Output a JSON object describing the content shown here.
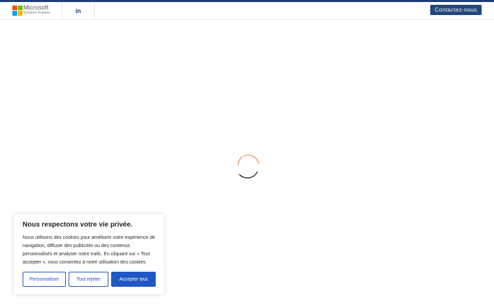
{
  "header": {
    "logo": {
      "title": "Microsoft",
      "subtitle": "Solution Partner",
      "colors": [
        "#f25022",
        "#7fba00",
        "#00a4ef",
        "#ffb900"
      ]
    },
    "linkedin": {
      "icon": "linkedin-icon",
      "glyph": "in"
    },
    "contact_label": "Contactez-nous",
    "colors": {
      "top_strip": "#1f3f73",
      "contact_button": "#22477a"
    }
  },
  "main": {
    "loading_icon": "spinner-icon",
    "spinner_colors": [
      "#e58a4e",
      "#1b1b1b"
    ]
  },
  "cookie_banner": {
    "title": "Nous respectons votre vie privée.",
    "body_lines": [
      "Nous utilisons des cookies pour améliorer votre expérience de",
      "navigation, diffuser des publicités ou des contenus",
      "personnalisés et analyser notre trafic. En cliquant sur « Tout",
      "accepter », vous consentez à notre utilisation des cookies."
    ],
    "buttons": {
      "customize": "Personnaliser",
      "reject_all": "Tout rejeter",
      "accept_all": "Accepter tout"
    },
    "accent_color": "#1f57c3"
  }
}
